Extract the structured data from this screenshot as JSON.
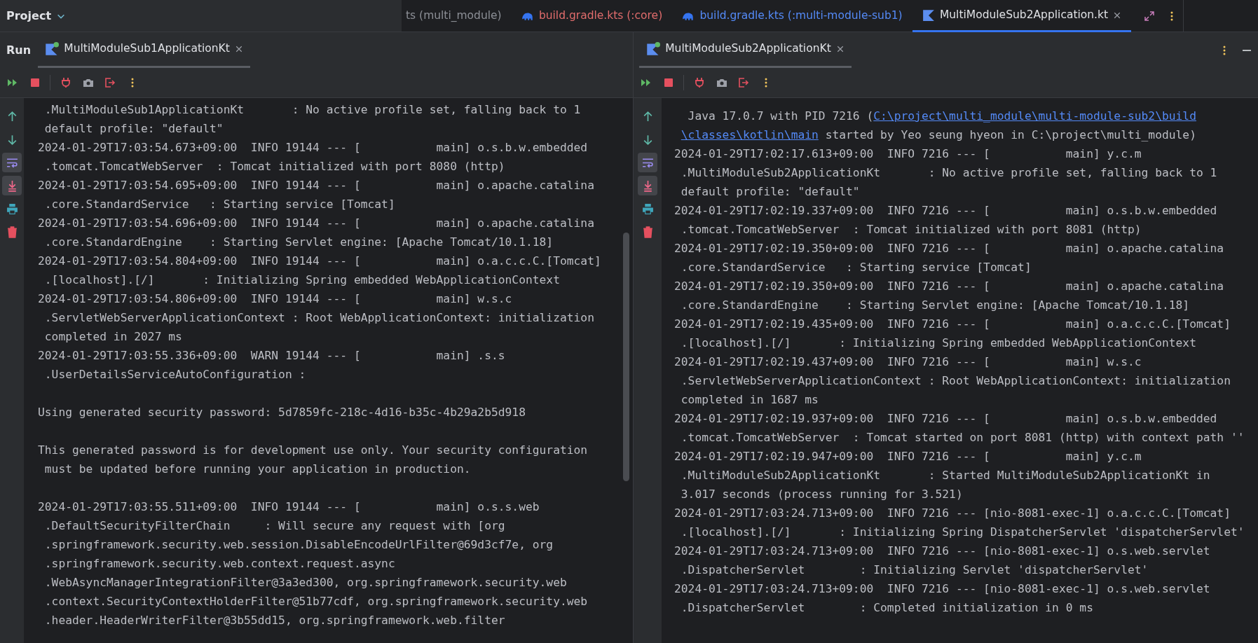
{
  "project": {
    "label": "Project"
  },
  "editor_tabs": [
    {
      "label": "ts (multi_module)",
      "kind": "plain",
      "color": "#8c8f96",
      "selected": false
    },
    {
      "label": "build.gradle.kts (:core)",
      "kind": "gradle",
      "color": "#e06c6c",
      "selected": false
    },
    {
      "label": "build.gradle.kts (:multi-module-sub1)",
      "kind": "gradle",
      "color": "#548af7",
      "selected": false
    },
    {
      "label": "MultiModuleSub2Application.kt",
      "kind": "kotlin",
      "color": "#dfe1e5",
      "selected": true
    }
  ],
  "editor_actions": [
    {
      "kind": "expand"
    },
    {
      "kind": "more"
    }
  ],
  "run": {
    "label": "Run"
  },
  "panes": [
    {
      "tab": {
        "label": "MultiModuleSub1ApplicationKt",
        "selected": true,
        "running": true
      },
      "toolbar": [
        {
          "kind": "rerun"
        },
        {
          "kind": "stop"
        },
        {
          "kind": "separator"
        },
        {
          "kind": "plug"
        },
        {
          "kind": "camera"
        },
        {
          "kind": "exit"
        },
        {
          "kind": "more"
        }
      ],
      "gutter": [
        {
          "kind": "up",
          "on": false
        },
        {
          "kind": "down",
          "on": false
        },
        {
          "kind": "wrap",
          "on": true
        },
        {
          "kind": "scroll-end",
          "on": true
        },
        {
          "kind": "print",
          "on": false
        },
        {
          "kind": "delete",
          "on": false
        }
      ],
      "scrollbar": true,
      "lines": [
        {
          "kind": "text",
          "text": " .MultiModuleSub1ApplicationKt       : No active profile set, falling back to 1"
        },
        {
          "kind": "text",
          "text": " default profile: \"default\""
        },
        {
          "kind": "text",
          "text": "2024-01-29T17:03:54.673+09:00  INFO 19144 --- [           main] o.s.b.w.embedded"
        },
        {
          "kind": "text",
          "text": " .tomcat.TomcatWebServer  : Tomcat initialized with port 8080 (http)"
        },
        {
          "kind": "text",
          "text": "2024-01-29T17:03:54.695+09:00  INFO 19144 --- [           main] o.apache.catalina"
        },
        {
          "kind": "text",
          "text": " .core.StandardService   : Starting service [Tomcat]"
        },
        {
          "kind": "text",
          "text": "2024-01-29T17:03:54.696+09:00  INFO 19144 --- [           main] o.apache.catalina"
        },
        {
          "kind": "text",
          "text": " .core.StandardEngine    : Starting Servlet engine: [Apache Tomcat/10.1.18]"
        },
        {
          "kind": "text",
          "text": "2024-01-29T17:03:54.804+09:00  INFO 19144 --- [           main] o.a.c.c.C.[Tomcat]"
        },
        {
          "kind": "text",
          "text": " .[localhost].[/]       : Initializing Spring embedded WebApplicationContext"
        },
        {
          "kind": "text",
          "text": "2024-01-29T17:03:54.806+09:00  INFO 19144 --- [           main] w.s.c"
        },
        {
          "kind": "text",
          "text": " .ServletWebServerApplicationContext : Root WebApplicationContext: initialization"
        },
        {
          "kind": "text",
          "text": " completed in 2027 ms"
        },
        {
          "kind": "text",
          "text": "2024-01-29T17:03:55.336+09:00  WARN 19144 --- [           main] .s.s"
        },
        {
          "kind": "text",
          "text": " .UserDetailsServiceAutoConfiguration :"
        },
        {
          "kind": "blank"
        },
        {
          "kind": "text",
          "text": "Using generated security password: 5d7859fc-218c-4d16-b35c-4b29a2b5d918"
        },
        {
          "kind": "blank"
        },
        {
          "kind": "text",
          "text": "This generated password is for development use only. Your security configuration"
        },
        {
          "kind": "text",
          "text": " must be updated before running your application in production."
        },
        {
          "kind": "blank"
        },
        {
          "kind": "text",
          "text": "2024-01-29T17:03:55.511+09:00  INFO 19144 --- [           main] o.s.s.web"
        },
        {
          "kind": "text",
          "text": " .DefaultSecurityFilterChain     : Will secure any request with [org"
        },
        {
          "kind": "text",
          "text": " .springframework.security.web.session.DisableEncodeUrlFilter@69d3cf7e, org"
        },
        {
          "kind": "text",
          "text": " .springframework.security.web.context.request.async"
        },
        {
          "kind": "text",
          "text": " .WebAsyncManagerIntegrationFilter@3a3ed300, org.springframework.security.web"
        },
        {
          "kind": "text",
          "text": " .context.SecurityContextHolderFilter@51b77cdf, org.springframework.security.web"
        },
        {
          "kind": "text",
          "text": " .header.HeaderWriterFilter@3b55dd15, org.springframework.web.filter"
        }
      ]
    },
    {
      "tab": {
        "label": "MultiModuleSub2ApplicationKt",
        "selected": true,
        "running": true
      },
      "header_icons": [
        {
          "kind": "more"
        },
        {
          "kind": "minimize"
        }
      ],
      "toolbar": [
        {
          "kind": "rerun"
        },
        {
          "kind": "stop"
        },
        {
          "kind": "separator"
        },
        {
          "kind": "plug"
        },
        {
          "kind": "camera"
        },
        {
          "kind": "exit"
        },
        {
          "kind": "more"
        }
      ],
      "gutter": [
        {
          "kind": "up",
          "on": false
        },
        {
          "kind": "down",
          "on": false
        },
        {
          "kind": "wrap",
          "on": true
        },
        {
          "kind": "scroll-end",
          "on": true
        },
        {
          "kind": "print",
          "on": false
        },
        {
          "kind": "delete",
          "on": false
        }
      ],
      "lines": [
        {
          "kind": "link",
          "before": "  Java 17.0.7 with PID 7216 (",
          "link": "C:\\project\\multi_module\\multi-module-sub2\\build"
        },
        {
          "kind": "link",
          "indented": true,
          "link": "\\classes\\kotlin\\main",
          "after": " started by Yeo seung hyeon in C:\\project\\multi_module)"
        },
        {
          "kind": "text",
          "text": "2024-01-29T17:02:17.613+09:00  INFO 7216 --- [           main] y.c.m"
        },
        {
          "kind": "text",
          "text": " .MultiModuleSub2ApplicationKt       : No active profile set, falling back to 1"
        },
        {
          "kind": "text",
          "text": " default profile: \"default\""
        },
        {
          "kind": "text",
          "text": "2024-01-29T17:02:19.337+09:00  INFO 7216 --- [           main] o.s.b.w.embedded"
        },
        {
          "kind": "text",
          "text": " .tomcat.TomcatWebServer  : Tomcat initialized with port 8081 (http)"
        },
        {
          "kind": "text",
          "text": "2024-01-29T17:02:19.350+09:00  INFO 7216 --- [           main] o.apache.catalina"
        },
        {
          "kind": "text",
          "text": " .core.StandardService   : Starting service [Tomcat]"
        },
        {
          "kind": "text",
          "text": "2024-01-29T17:02:19.350+09:00  INFO 7216 --- [           main] o.apache.catalina"
        },
        {
          "kind": "text",
          "text": " .core.StandardEngine    : Starting Servlet engine: [Apache Tomcat/10.1.18]"
        },
        {
          "kind": "text",
          "text": "2024-01-29T17:02:19.435+09:00  INFO 7216 --- [           main] o.a.c.c.C.[Tomcat]"
        },
        {
          "kind": "text",
          "text": " .[localhost].[/]       : Initializing Spring embedded WebApplicationContext"
        },
        {
          "kind": "text",
          "text": "2024-01-29T17:02:19.437+09:00  INFO 7216 --- [           main] w.s.c"
        },
        {
          "kind": "text",
          "text": " .ServletWebServerApplicationContext : Root WebApplicationContext: initialization"
        },
        {
          "kind": "text",
          "text": " completed in 1687 ms"
        },
        {
          "kind": "text",
          "text": "2024-01-29T17:02:19.937+09:00  INFO 7216 --- [           main] o.s.b.w.embedded"
        },
        {
          "kind": "text",
          "text": " .tomcat.TomcatWebServer  : Tomcat started on port 8081 (http) with context path ''"
        },
        {
          "kind": "text",
          "text": "2024-01-29T17:02:19.947+09:00  INFO 7216 --- [           main] y.c.m"
        },
        {
          "kind": "text",
          "text": " .MultiModuleSub2ApplicationKt       : Started MultiModuleSub2ApplicationKt in"
        },
        {
          "kind": "text",
          "text": " 3.017 seconds (process running for 3.521)"
        },
        {
          "kind": "text",
          "text": "2024-01-29T17:03:24.713+09:00  INFO 7216 --- [nio-8081-exec-1] o.a.c.c.C.[Tomcat]"
        },
        {
          "kind": "text",
          "text": " .[localhost].[/]       : Initializing Spring DispatcherServlet 'dispatcherServlet'"
        },
        {
          "kind": "text",
          "text": "2024-01-29T17:03:24.713+09:00  INFO 7216 --- [nio-8081-exec-1] o.s.web.servlet"
        },
        {
          "kind": "text",
          "text": " .DispatcherServlet        : Initializing Servlet 'dispatcherServlet'"
        },
        {
          "kind": "text",
          "text": "2024-01-29T17:03:24.713+09:00  INFO 7216 --- [nio-8081-exec-1] o.s.web.servlet"
        },
        {
          "kind": "text",
          "text": " .DispatcherServlet        : Completed initialization in 0 ms"
        }
      ]
    }
  ]
}
